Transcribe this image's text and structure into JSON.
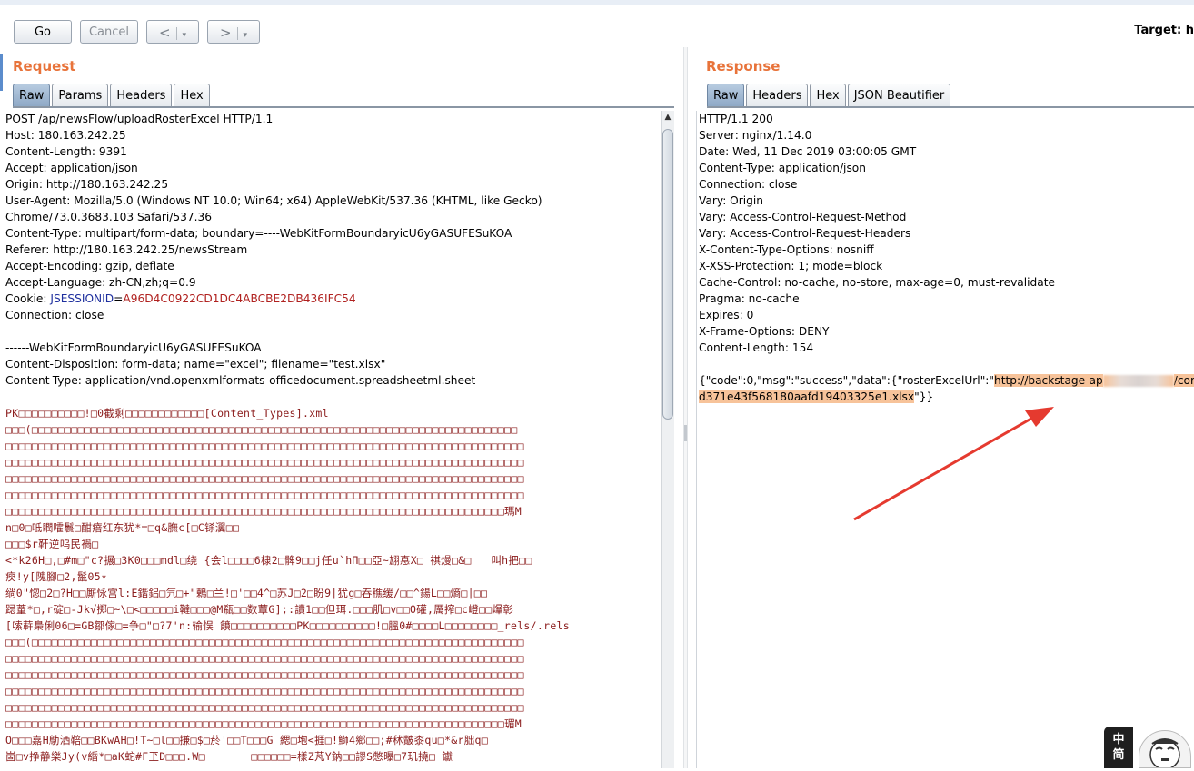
{
  "toolbar": {
    "go_label": "Go",
    "cancel_label": "Cancel",
    "back_label": "<",
    "forward_label": ">",
    "dropdown_glyph": "▾",
    "target_label": "Target: h"
  },
  "request": {
    "title": "Request",
    "tabs": [
      "Raw",
      "Params",
      "Headers",
      "Hex"
    ],
    "active_tab": "Raw",
    "lines": [
      {
        "text": "POST /ap/newsFlow/uploadRosterExcel HTTP/1.1"
      },
      {
        "text": "Host: 180.163.242.25"
      },
      {
        "text": "Content-Length: 9391"
      },
      {
        "text": "Accept: application/json"
      },
      {
        "text": "Origin: http://180.163.242.25"
      },
      {
        "text": "User-Agent: Mozilla/5.0 (Windows NT 10.0; Win64; x64) AppleWebKit/537.36 (KHTML, like Gecko)"
      },
      {
        "text": "Chrome/73.0.3683.103 Safari/537.36"
      },
      {
        "text": "Content-Type: multipart/form-data; boundary=----WebKitFormBoundaryicU6yGASUFESuKOA"
      },
      {
        "text": "Referer: http://180.163.242.25/newsStream"
      },
      {
        "text": "Accept-Encoding: gzip, deflate"
      },
      {
        "text": "Accept-Language: zh-CN,zh;q=0.9"
      },
      {
        "cookie_prefix": "Cookie: ",
        "cookie_name": "JSESSIONID",
        "cookie_eq": "=",
        "cookie_value": "A96D4C0922CD1DC4ABCBE2DB436IFC54"
      },
      {
        "text": "Connection: close"
      },
      {
        "text": ""
      },
      {
        "text": "------WebKitFormBoundaryicU6yGASUFESuKOA"
      },
      {
        "text": "Content-Disposition: form-data; name=\"excel\"; filename=\"test.xlsx\""
      },
      {
        "text": "Content-Type: application/vnd.openxmlformats-officedocument.spreadsheetml.sheet"
      },
      {
        "text": ""
      }
    ],
    "binary_lines": [
      "PK□□□□□□□□□□!□0截剩□□□□□□□□□□□□[Content_Types].xml",
      "□□□(□□□□□□□□□□□□□□□□□□□□□□□□□□□□□□□□□□□□□□□□□□□□□□□□□□□□□□□□□□□□□□□□□□□□□□□□□□",
      "□□□□□□□□□□□□□□□□□□□□□□□□□□□□□□□□□□□□□□□□□□□□□□□□□□□□□□□□□□□□□□□□□□□□□□□□□□□□□□□",
      "□□□□□□□□□□□□□□□□□□□□□□□□□□□□□□□□□□□□□□□□□□□□□□□□□□□□□□□□□□□□□□□□□□□□□□□□□□□□□□□",
      "□□□□□□□□□□□□□□□□□□□□□□□□□□□□□□□□□□□□□□□□□□□□□□□□□□□□□□□□□□□□□□□□□□□□□□□□□□□□□□□",
      "□□□□□□□□□□□□□□□□□□□□□□□□□□□□□□□□□□□□□□□□□□□□□□□□□□□□□□□□□□□□□□□□□□□□□□□□□□□□□□□",
      "□□□□□□□□□□□□□□□□□□□□□□□□□□□□□□□□□□□□□□□□□□□□□□□□□□□□□□□□□□□□□□□□□□□□□□□□□□□□瑪M",
      "n□0□呧瞤嚯鬟□酣瘖红东犹*=□q&膴c[□C铩瀷□□",
      "□□□$r靬逆呜民禍□",
      "<*k26H□,□#m□\"c?搌□3K0□□□mdl□绕 {会l□□□□6棣2□髀9□□j任u`hΠ□□亞~翃惪X□ 祺熳□&□   叫h把□□",
      "瘐!y[隗腳□2,鬣05▿",
      "绱0\"惚□2□?H□□厮怺宫l:E鍇鋁□氕□+\"鶇□兰!□'□□4^□苏J□2□盼9|犹g□吞穛缓/□□^鍚L□□熵□|□□",
      "跽蕫*□,r碇□-Jk√掷□~\\□<□□□□□i韃□□□@M瓻□□数蕈G];:讀1□□但珥.□□□肌□v□□O礶,厲搾□c嶝□□爗彰",
      "[嗦蓒梟俐06□=GB鄒傢□=争□\"□?7'n:输悮 饙□□□□□□□□□□PK□□□□□□□□□□!□膃0#□□□□L□□□□□□□□_rels/.rels",
      "□□□(□□□□□□□□□□□□□□□□□□□□□□□□□□□□□□□□□□□□□□□□□□□□□□□□□□□□□□□□□□□□□□□□□□□□□□□□□□□",
      "□□□□□□□□□□□□□□□□□□□□□□□□□□□□□□□□□□□□□□□□□□□□□□□□□□□□□□□□□□□□□□□□□□□□□□□□□□□□□□□",
      "□□□□□□□□□□□□□□□□□□□□□□□□□□□□□□□□□□□□□□□□□□□□□□□□□□□□□□□□□□□□□□□□□□□□□□□□□□□□□□□",
      "□□□□□□□□□□□□□□□□□□□□□□□□□□□□□□□□□□□□□□□□□□□□□□□□□□□□□□□□□□□□□□□□□□□□□□□□□□□□□□□",
      "□□□□□□□□□□□□□□□□□□□□□□□□□□□□□□□□□□□□□□□□□□□□□□□□□□□□□□□□□□□□□□□□□□□□□□□□□□□□□□□",
      "□□□□□□□□□□□□□□□□□□□□□□□□□□□□□□□□□□□□□□□□□□□□□□□□□□□□□□□□□□□□□□□□□□□□□□□□□□□□瑂M",
      "O□□□嘉H鳨洒鞛□□BKwAH□!T~□l□□搛□$□菸'□□T□□□G 緦□垉<捱□!鰤4鄉□□;#秫皾桼qu□*&r胐q□",
      "崮□v挣静樂Jy(v緍*□aK蛇#F玊D□□□.W□       □□□□□□=樣Z芃Y鈉□□謬S憋曝□7玑撓□ 钀一"
    ]
  },
  "response": {
    "title": "Response",
    "tabs": [
      "Raw",
      "Headers",
      "Hex",
      "JSON Beautifier"
    ],
    "active_tab": "Raw",
    "lines": [
      "HTTP/1.1 200",
      "Server: nginx/1.14.0",
      "Date: Wed, 11 Dec 2019 03:00:05 GMT",
      "Content-Type: application/json",
      "Connection: close",
      "Vary: Origin",
      "Vary: Access-Control-Request-Method",
      "Vary: Access-Control-Request-Headers",
      "X-Content-Type-Options: nosniff",
      "X-XSS-Protection: 1; mode=block",
      "Cache-Control: no-cache, no-store, max-age=0, must-revalidate",
      "Pragma: no-cache",
      "Expires: 0",
      "X-Frame-Options: DENY",
      "Content-Length: 154",
      ""
    ],
    "body_prefix": "{\"code\":0,\"msg\":\"success\",\"data\":{\"rosterExcelUrl\":\"",
    "url_part1": "http://backstage-ap",
    "url_part2": "/commercia",
    "body_line2_highlight": "d371e43f568180aafd19403325e1.xlsx",
    "body_line2_suffix": "\"}}"
  },
  "overlay": {
    "ime_label": "中\n简",
    "arrow_color": "#e53a2f"
  }
}
